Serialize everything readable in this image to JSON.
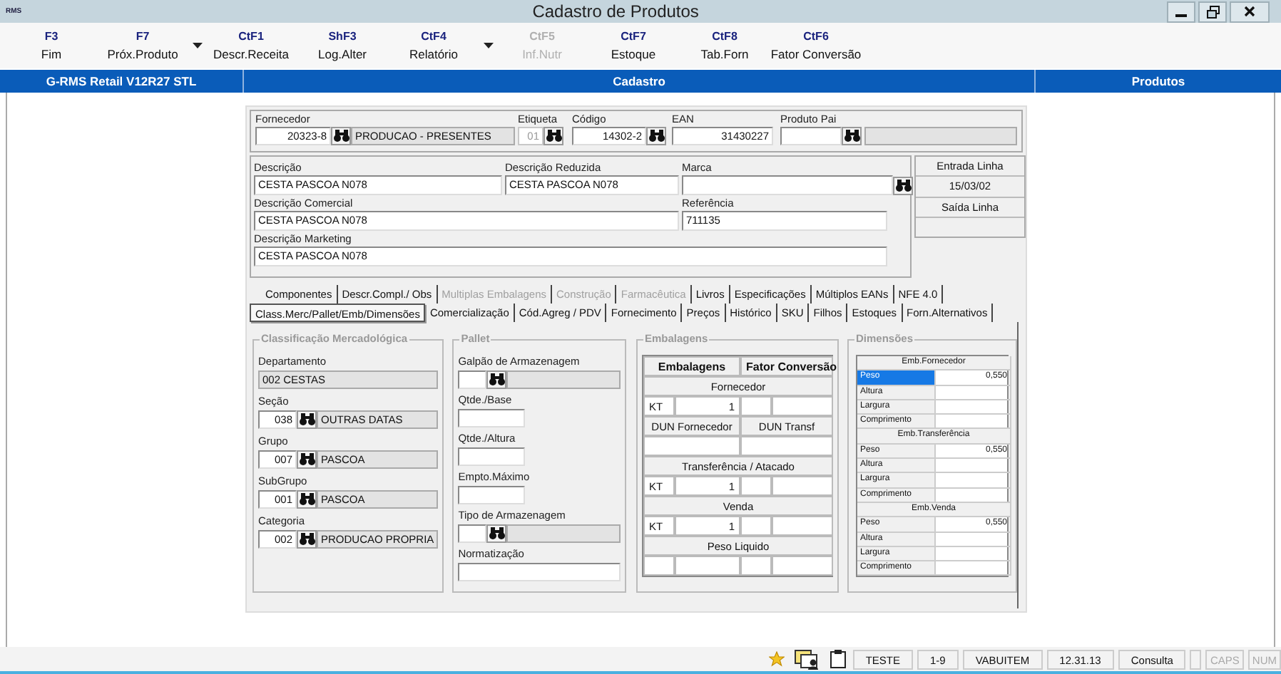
{
  "window": {
    "logo": "RMS",
    "title": "Cadastro de Produtos"
  },
  "toolbar": [
    {
      "key": "F3",
      "label": "Fim",
      "disabled": false,
      "dropdown": false
    },
    {
      "key": "F7",
      "label": "Próx.Produto",
      "disabled": false,
      "dropdown": true
    },
    {
      "key": "CtF1",
      "label": "Descr.Receita",
      "disabled": false,
      "dropdown": false
    },
    {
      "key": "ShF3",
      "label": "Log.Alter",
      "disabled": false,
      "dropdown": false
    },
    {
      "key": "CtF4",
      "label": "Relatório",
      "disabled": false,
      "dropdown": true
    },
    {
      "key": "CtF5",
      "label": "Inf.Nutr",
      "disabled": true,
      "dropdown": false
    },
    {
      "key": "CtF7",
      "label": "Estoque",
      "disabled": false,
      "dropdown": false
    },
    {
      "key": "CtF8",
      "label": "Tab.Forn",
      "disabled": false,
      "dropdown": false
    },
    {
      "key": "CtF6",
      "label": "Fator Conversão",
      "disabled": false,
      "dropdown": false
    }
  ],
  "header_bar": {
    "system": "G-RMS Retail V12R27  STL",
    "section": "Cadastro",
    "module": "Produtos"
  },
  "product_header": [
    {
      "label": "Fornecedor",
      "kind": "lookup_name",
      "code": "20323-8",
      "name": "PRODUCAO - PRESENTES",
      "disabled": false
    },
    {
      "label": "Etiqueta",
      "kind": "lookup",
      "value": "01",
      "disabled": true
    },
    {
      "label": "Código",
      "kind": "lookup",
      "value": "14302-2",
      "disabled": false
    },
    {
      "label": "EAN",
      "kind": "input",
      "value": "31430227",
      "disabled": false
    },
    {
      "label": "Produto Pai",
      "kind": "lookup_name",
      "disabled": false
    }
  ],
  "descriptions": [
    [
      {
        "label": "Descrição",
        "value": "CESTA PASCOA N078",
        "lookup": false
      },
      {
        "label": "Descrição Reduzida",
        "value": "CESTA PASCOA N078",
        "lookup": false
      },
      {
        "label": "Marca",
        "lookup": true
      }
    ],
    [
      {
        "label": "Descrição Comercial",
        "value": "CESTA PASCOA N078",
        "lookup": false
      },
      {
        "label": "Referência",
        "value": "711135",
        "lookup": false
      }
    ],
    [
      {
        "label": "Descrição Marketing",
        "value": "CESTA PASCOA N078",
        "lookup": false
      }
    ]
  ],
  "line_dates": [
    {
      "kind": "label",
      "text": "Entrada Linha"
    },
    {
      "kind": "value",
      "text": "15/03/02"
    },
    {
      "kind": "label",
      "text": "Saída Linha"
    },
    {
      "kind": "value"
    }
  ],
  "tab_rows": [
    [
      {
        "label": "Componentes",
        "selected": false,
        "disabled": false
      },
      {
        "label": "Descr.Compl./ Obs",
        "selected": false,
        "disabled": false
      },
      {
        "label": "Multiplas Embalagens",
        "selected": false,
        "disabled": true
      },
      {
        "label": "Construção",
        "selected": false,
        "disabled": true
      },
      {
        "label": "Farmacêutica",
        "selected": false,
        "disabled": true
      },
      {
        "label": "Livros",
        "selected": false,
        "disabled": false
      },
      {
        "label": "Especificações",
        "selected": false,
        "disabled": false
      },
      {
        "label": "Múltiplos EANs",
        "selected": false,
        "disabled": false
      },
      {
        "label": "NFE 4.0",
        "selected": false,
        "disabled": false
      }
    ],
    [
      {
        "label": "Class.Merc/Pallet/Emb/Dimensões",
        "selected": true,
        "disabled": false
      },
      {
        "label": "Comercialização",
        "selected": false,
        "disabled": false
      },
      {
        "label": "Cód.Agreg / PDV",
        "selected": false,
        "disabled": false
      },
      {
        "label": "Fornecimento",
        "selected": false,
        "disabled": false
      },
      {
        "label": "Preços",
        "selected": false,
        "disabled": false
      },
      {
        "label": "Histórico",
        "selected": false,
        "disabled": false
      },
      {
        "label": "SKU",
        "selected": false,
        "disabled": false
      },
      {
        "label": "Filhos",
        "selected": false,
        "disabled": false
      },
      {
        "label": "Estoques",
        "selected": false,
        "disabled": false
      },
      {
        "label": "Forn.Alternativos",
        "selected": false,
        "disabled": false
      }
    ]
  ],
  "classificacao": {
    "title": "Classificação Mercadológica",
    "fields": [
      {
        "label": "Departamento",
        "kind": "text",
        "value": "002 CESTAS"
      },
      {
        "label": "Seção",
        "kind": "lookup",
        "code": "038",
        "name": "OUTRAS DATAS"
      },
      {
        "label": "Grupo",
        "kind": "lookup",
        "code": "007",
        "name": "PASCOA"
      },
      {
        "label": "SubGrupo",
        "kind": "lookup",
        "code": "001",
        "name": "PASCOA"
      },
      {
        "label": "Categoria",
        "kind": "lookup",
        "code": "002",
        "name": "PRODUCAO PROPRIA"
      }
    ]
  },
  "pallet": {
    "title": "Pallet",
    "fields": [
      {
        "label": "Galpão de Armazenagem",
        "kind": "lookup"
      },
      {
        "label": "Qtde./Base",
        "kind": "short"
      },
      {
        "label": "Qtde./Altura",
        "kind": "short"
      },
      {
        "label": "Empto.Máximo",
        "kind": "short"
      },
      {
        "label": "Tipo de Armazenagem",
        "kind": "lookup"
      },
      {
        "label": "Normatização",
        "kind": "long"
      }
    ]
  },
  "embalagens": {
    "title": "Embalagens",
    "rows": [
      {
        "kind": "header",
        "cells": [
          "Embalagens",
          "Fator Conversão"
        ]
      },
      {
        "kind": "section",
        "label": "Fornecedor"
      },
      {
        "kind": "values",
        "unit": "KT",
        "quantity": "1"
      },
      {
        "kind": "labels",
        "cells": [
          "DUN Fornecedor",
          "DUN Transf"
        ]
      },
      {
        "kind": "pair"
      },
      {
        "kind": "section",
        "label": "Transferência / Atacado"
      },
      {
        "kind": "values",
        "unit": "KT",
        "quantity": "1"
      },
      {
        "kind": "section",
        "label": "Venda"
      },
      {
        "kind": "values",
        "unit": "KT",
        "quantity": "1"
      },
      {
        "kind": "section",
        "label": "Peso Liquido"
      },
      {
        "kind": "blank"
      }
    ]
  },
  "dimensoes": {
    "title": "Dimensões",
    "groups": [
      {
        "title": "Emb.Fornecedor",
        "rows": [
          {
            "label": "Peso",
            "value": "0,550",
            "selected": true
          },
          {
            "label": "Altura",
            "selected": false
          },
          {
            "label": "Largura",
            "selected": false
          },
          {
            "label": "Comprimento",
            "selected": false
          }
        ]
      },
      {
        "title": "Emb.Transferência",
        "rows": [
          {
            "label": "Peso",
            "value": "0,550",
            "selected": false
          },
          {
            "label": "Altura",
            "selected": false
          },
          {
            "label": "Largura",
            "selected": false
          },
          {
            "label": "Comprimento",
            "selected": false
          }
        ]
      },
      {
        "title": "Emb.Venda",
        "rows": [
          {
            "label": "Peso",
            "value": "0,550",
            "selected": false
          },
          {
            "label": "Altura",
            "selected": false
          },
          {
            "label": "Largura",
            "selected": false
          },
          {
            "label": "Comprimento",
            "selected": false
          }
        ]
      }
    ]
  },
  "status_bar": [
    {
      "kind": "star"
    },
    {
      "kind": "windows"
    },
    {
      "kind": "clipboard"
    },
    {
      "kind": "text",
      "text": "TESTE"
    },
    {
      "kind": "text",
      "text": "1-9"
    },
    {
      "kind": "text",
      "text": "VABUITEM"
    },
    {
      "kind": "text",
      "text": "12.31.13"
    },
    {
      "kind": "text",
      "text": "Consulta"
    },
    {
      "kind": "blank"
    },
    {
      "kind": "dim",
      "text": "CAPS"
    },
    {
      "kind": "dim",
      "text": "NUM"
    }
  ]
}
